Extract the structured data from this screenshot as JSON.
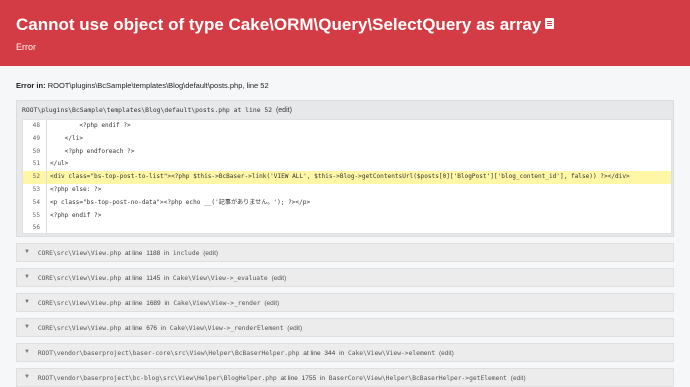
{
  "header": {
    "title": "Cannot use object of type Cake\\ORM\\Query\\SelectQuery as array",
    "subtitle": "Error"
  },
  "error_in": {
    "label": "Error in:",
    "location": "ROOT\\plugins\\BcSample\\templates\\Blog\\default\\posts.php, line 52"
  },
  "frame": {
    "file": "ROOT\\plugins\\BcSample\\templates\\Blog\\default\\posts.php at line 52",
    "edit": "(edit)",
    "lines": [
      {
        "n": "48",
        "code": "        <?php endif ?>"
      },
      {
        "n": "49",
        "code": "    </li>"
      },
      {
        "n": "50",
        "code": "    <?php endforeach ?>"
      },
      {
        "n": "51",
        "code": "</ul>"
      },
      {
        "n": "52",
        "code": "<div class=\"bs-top-post-to-list\"><?php $this->BcBaser->link('VIEW ALL', $this->Blog->getContentsUrl($posts[0]['BlogPost']['blog_content_id'], false)) ?></div>"
      },
      {
        "n": "53",
        "code": "<?php else: ?>"
      },
      {
        "n": "54",
        "code": "<p class=\"bs-top-post-no-data\"><?php echo __('記事がありません。'); ?></p>"
      },
      {
        "n": "55",
        "code": "<?php endif ?>"
      },
      {
        "n": "56",
        "code": ""
      }
    ]
  },
  "trace": [
    {
      "path": "CORE\\src\\View\\View.php",
      "at": "at line",
      "line": "1188",
      "in": "in",
      "fn": "include",
      "edit": "(edit)"
    },
    {
      "path": "CORE\\src\\View\\View.php",
      "at": "at line",
      "line": "1145",
      "in": "in",
      "fn": "Cake\\View\\View->_evaluate",
      "edit": "(edit)"
    },
    {
      "path": "CORE\\src\\View\\View.php",
      "at": "at line",
      "line": "1689",
      "in": "in",
      "fn": "Cake\\View\\View->_render",
      "edit": "(edit)"
    },
    {
      "path": "CORE\\src\\View\\View.php",
      "at": "at line",
      "line": "676",
      "in": "in",
      "fn": "Cake\\View\\View->_renderElement",
      "edit": "(edit)"
    },
    {
      "path": "ROOT\\vendor\\baserproject\\baser-core\\src\\View\\Helper\\BcBaserHelper.php",
      "at": "at line",
      "line": "344",
      "in": "in",
      "fn": "Cake\\View\\View->element",
      "edit": "(edit)"
    },
    {
      "path": "ROOT\\vendor\\baserproject\\bc-blog\\src\\View\\Helper\\BlogHelper.php",
      "at": "at line",
      "line": "1755",
      "in": "in",
      "fn": "BaserCore\\View\\Helper\\BcBaserHelper->getElement",
      "edit": "(edit)"
    }
  ]
}
